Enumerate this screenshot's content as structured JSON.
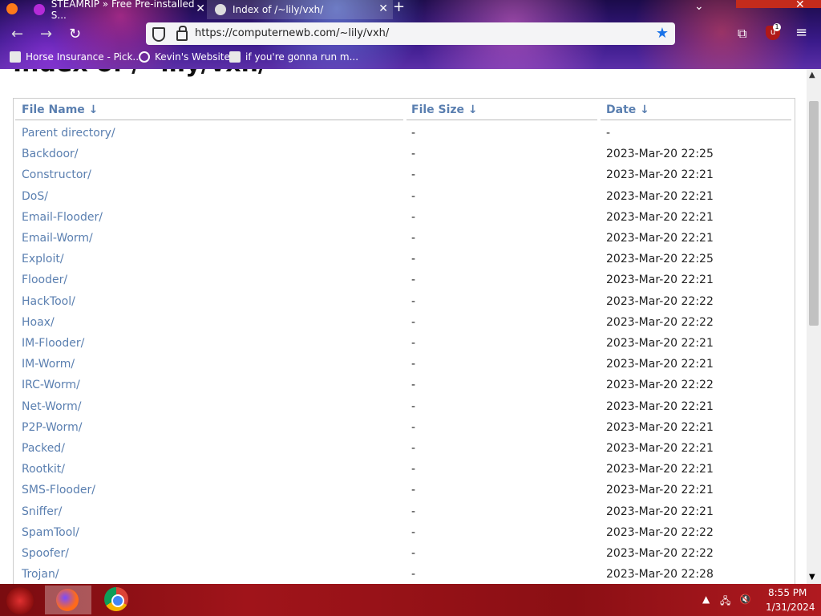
{
  "browser": {
    "tabs": [
      {
        "label": "STEAMRIP » Free Pre-installed S..."
      },
      {
        "label": "Index of /~lily/vxh/"
      }
    ],
    "new_tab": "+",
    "url": "https://computernewb.com/~lily/vxh/",
    "bookmarks": [
      {
        "label": "Horse Insurance - Pick..."
      },
      {
        "label": "Kevin's Website"
      },
      {
        "label": "if you're gonna run m..."
      }
    ],
    "extension_badge": "1"
  },
  "page": {
    "title": "Index of /~lily/vxh/",
    "columns": {
      "name": "File Name  ↓",
      "size": "File Size  ↓",
      "date": "Date  ↓"
    },
    "rows": [
      {
        "name": "Parent directory/",
        "size": "-",
        "date": "-"
      },
      {
        "name": "Backdoor/",
        "size": "-",
        "date": "2023-Mar-20 22:25"
      },
      {
        "name": "Constructor/",
        "size": "-",
        "date": "2023-Mar-20 22:21"
      },
      {
        "name": "DoS/",
        "size": "-",
        "date": "2023-Mar-20 22:21"
      },
      {
        "name": "Email-Flooder/",
        "size": "-",
        "date": "2023-Mar-20 22:21"
      },
      {
        "name": "Email-Worm/",
        "size": "-",
        "date": "2023-Mar-20 22:21"
      },
      {
        "name": "Exploit/",
        "size": "-",
        "date": "2023-Mar-20 22:25"
      },
      {
        "name": "Flooder/",
        "size": "-",
        "date": "2023-Mar-20 22:21"
      },
      {
        "name": "HackTool/",
        "size": "-",
        "date": "2023-Mar-20 22:22"
      },
      {
        "name": "Hoax/",
        "size": "-",
        "date": "2023-Mar-20 22:22"
      },
      {
        "name": "IM-Flooder/",
        "size": "-",
        "date": "2023-Mar-20 22:21"
      },
      {
        "name": "IM-Worm/",
        "size": "-",
        "date": "2023-Mar-20 22:21"
      },
      {
        "name": "IRC-Worm/",
        "size": "-",
        "date": "2023-Mar-20 22:22"
      },
      {
        "name": "Net-Worm/",
        "size": "-",
        "date": "2023-Mar-20 22:21"
      },
      {
        "name": "P2P-Worm/",
        "size": "-",
        "date": "2023-Mar-20 22:21"
      },
      {
        "name": "Packed/",
        "size": "-",
        "date": "2023-Mar-20 22:21"
      },
      {
        "name": "Rootkit/",
        "size": "-",
        "date": "2023-Mar-20 22:21"
      },
      {
        "name": "SMS-Flooder/",
        "size": "-",
        "date": "2023-Mar-20 22:21"
      },
      {
        "name": "Sniffer/",
        "size": "-",
        "date": "2023-Mar-20 22:21"
      },
      {
        "name": "SpamTool/",
        "size": "-",
        "date": "2023-Mar-20 22:22"
      },
      {
        "name": "Spoofer/",
        "size": "-",
        "date": "2023-Mar-20 22:22"
      },
      {
        "name": "Trojan/",
        "size": "-",
        "date": "2023-Mar-20 22:28"
      }
    ]
  },
  "taskbar": {
    "time": "8:55 PM",
    "date": "1/31/2024"
  }
}
